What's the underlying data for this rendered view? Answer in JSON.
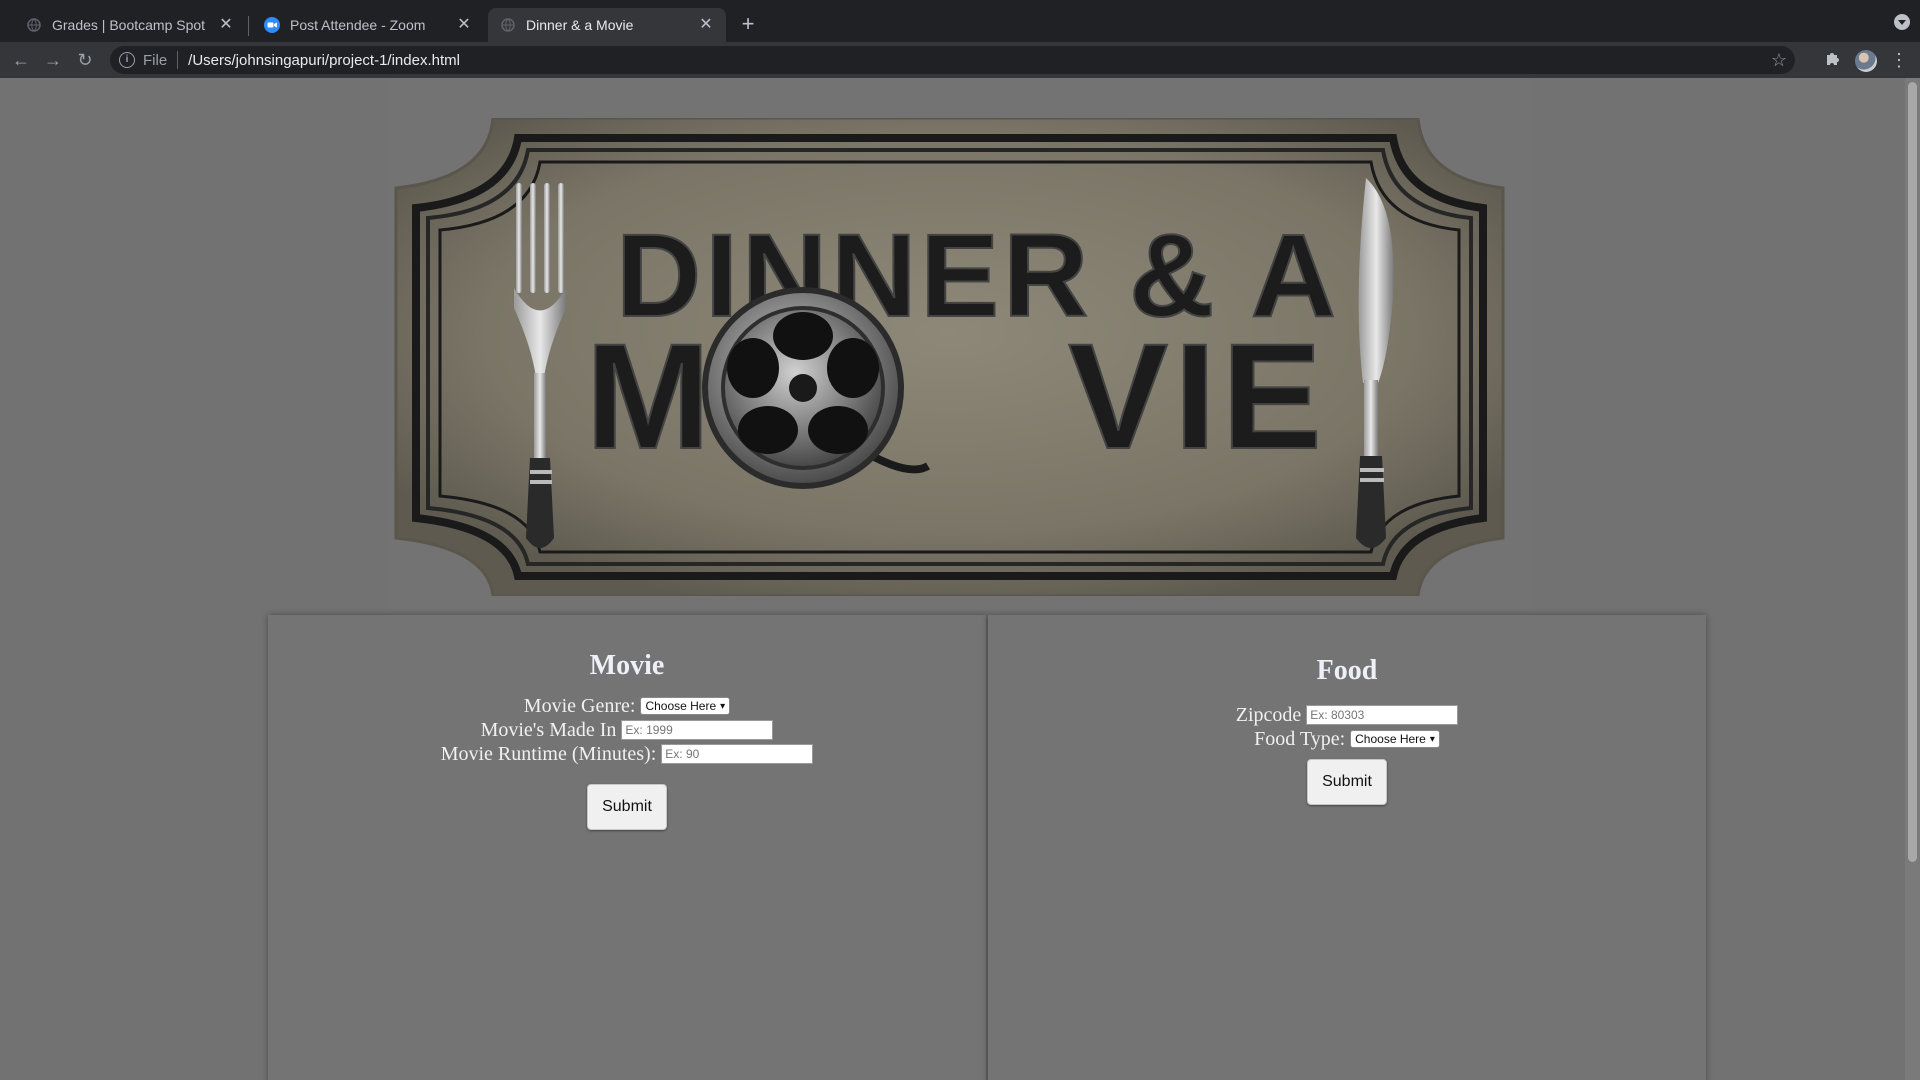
{
  "browser": {
    "tabs": [
      {
        "title": "Grades | Bootcamp Spot",
        "favicon": "globe-icon"
      },
      {
        "title": "Post Attendee - Zoom",
        "favicon": "zoom-icon"
      },
      {
        "title": "Dinner & a Movie",
        "favicon": "globe-icon",
        "active": true
      }
    ],
    "address": {
      "scheme": "File",
      "url": "/Users/johnsingapuri/project-1/index.html"
    }
  },
  "logo": {
    "line1": "DINNER & A",
    "line2_start": "M",
    "line2_end": "VIE",
    "colors": {
      "plaque": "#807b6c",
      "frame": "#1c1c1c",
      "text": "#181818"
    }
  },
  "movie": {
    "heading": "Movie",
    "genre_label": "Movie Genre:",
    "genre_value": "Choose Here",
    "year_label": "Movie's Made In",
    "year_placeholder": "Ex: 1999",
    "runtime_label": "Movie Runtime (Minutes):",
    "runtime_placeholder": "Ex: 90",
    "submit": "Submit"
  },
  "food": {
    "heading": "Food",
    "zip_label": "Zipcode",
    "zip_placeholder": "Ex: 80303",
    "type_label": "Food Type:",
    "type_value": "Choose Here",
    "submit": "Submit"
  }
}
